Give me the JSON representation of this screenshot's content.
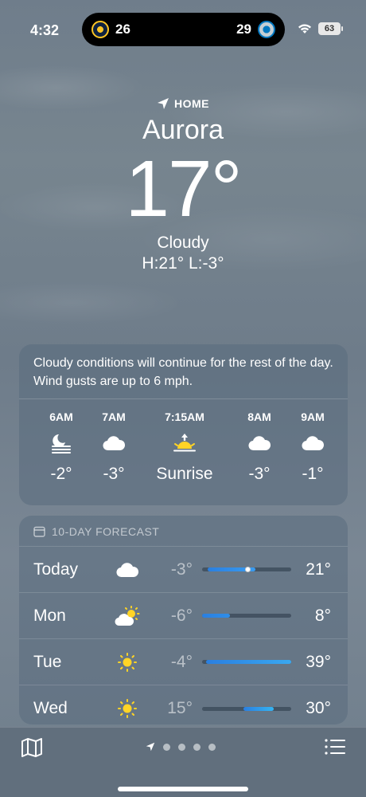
{
  "status": {
    "time": "4:32",
    "score_left": "26",
    "score_right": "29",
    "battery": "63"
  },
  "header": {
    "location_label": "HOME",
    "city": "Aurora",
    "temp": "17°",
    "condition": "Cloudy",
    "hi_lo": "H:21°  L:-3°"
  },
  "hourly": {
    "summary": "Cloudy conditions will continue for the rest of the day. Wind gusts are up to 6 mph.",
    "items": [
      {
        "time": "6AM",
        "icon": "moon-fog-icon",
        "temp": "-2°"
      },
      {
        "time": "7AM",
        "icon": "cloud-icon",
        "temp": "-3°"
      },
      {
        "time": "7:15AM",
        "icon": "sunrise-icon",
        "temp": "Sunrise"
      },
      {
        "time": "8AM",
        "icon": "cloud-icon",
        "temp": "-3°"
      },
      {
        "time": "9AM",
        "icon": "cloud-icon",
        "temp": "-1°"
      }
    ]
  },
  "daily": {
    "heading": "10-DAY FORECAST",
    "range": [
      -6,
      39
    ],
    "days": [
      {
        "day": "Today",
        "icon": "cloud-icon",
        "low": "-3°",
        "high": "21°",
        "low_v": -3,
        "high_v": 21,
        "current_v": 17,
        "color": "#3a9cf0"
      },
      {
        "day": "Mon",
        "icon": "partly-sunny-icon",
        "low": "-6°",
        "high": "8°",
        "low_v": -6,
        "high_v": 8,
        "color": "#2f8ee8"
      },
      {
        "day": "Tue",
        "icon": "sun-icon",
        "low": "-4°",
        "high": "39°",
        "low_v": -4,
        "high_v": 39,
        "color": "#3aa8f0"
      },
      {
        "day": "Wed",
        "icon": "sun-icon",
        "low": "15°",
        "high": "30°",
        "low_v": 15,
        "high_v": 30,
        "color": "#35b4f2"
      }
    ]
  },
  "colors": {
    "sun": "#ffd426",
    "accent_blue": "#3a9cf0"
  }
}
